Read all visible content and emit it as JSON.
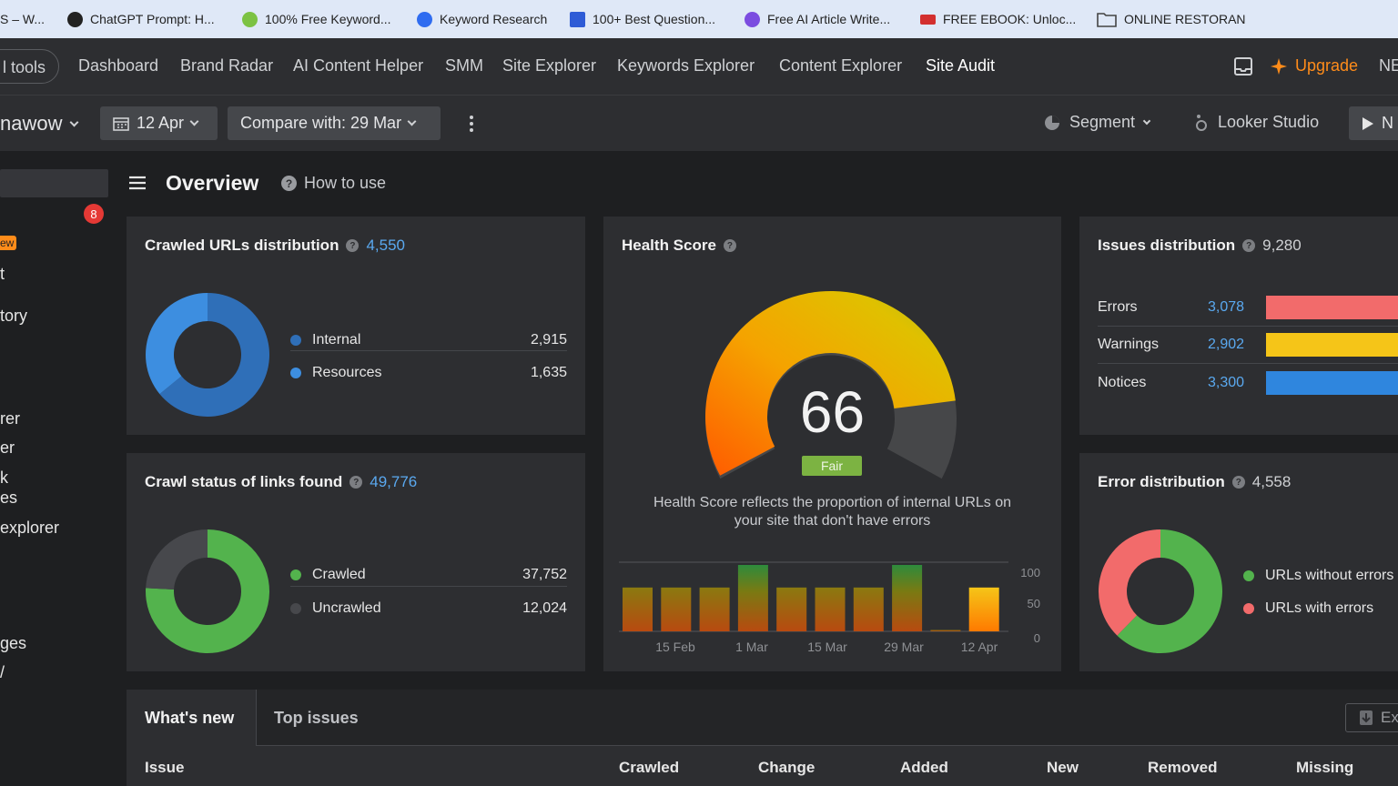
{
  "bookmarks": [
    {
      "label": "S – W...",
      "color": "#3b3b3b"
    },
    {
      "label": "ChatGPT Prompt: H...",
      "color": "#222222"
    },
    {
      "label": "100% Free Keyword...",
      "color": "#7cc243"
    },
    {
      "label": "Keyword Research",
      "color": "#2f6cf0"
    },
    {
      "label": "100+ Best Question...",
      "color": "#2e5bd6"
    },
    {
      "label": "Free AI Article Write...",
      "color": "#7b4ce0"
    },
    {
      "label": "FREE EBOOK: Unloc...",
      "color": "#d32f2f"
    },
    {
      "label": "ONLINE RESTORAN",
      "color": "folder"
    }
  ],
  "topnav": {
    "all_tools": "l tools",
    "items": [
      "Dashboard",
      "Brand Radar",
      "AI Content Helper",
      "SMM",
      "Site Explorer",
      "Keywords Explorer",
      "Content Explorer",
      "Site Audit"
    ],
    "upgrade": "Upgrade",
    "right_cut": "NE"
  },
  "projbar": {
    "project": "nawow",
    "date": "12 Apr",
    "compare": "Compare with: 29 Mar",
    "segment": "Segment",
    "looker": "Looker Studio",
    "run_cut": "N"
  },
  "sidebar": {
    "badge": "8",
    "new_tag": "ew",
    "items": [
      "t",
      "tory",
      "rer",
      "er",
      "k",
      "es",
      "explorer",
      "ges",
      "/"
    ]
  },
  "overview": {
    "title": "Overview",
    "how_to_use": "How to use"
  },
  "crawled_urls": {
    "title": "Crawled URLs distribution",
    "count": "4,550",
    "rows": [
      {
        "label": "Internal",
        "value": "2,915",
        "color": "#2f6fb8"
      },
      {
        "label": "Resources",
        "value": "1,635",
        "color": "#3d8ee0"
      }
    ]
  },
  "crawl_status": {
    "title": "Crawl status of links found",
    "count": "49,776",
    "rows": [
      {
        "label": "Crawled",
        "value": "37,752",
        "color": "#53b34d"
      },
      {
        "label": "Uncrawled",
        "value": "12,024",
        "color": "#47484c"
      }
    ]
  },
  "health": {
    "title": "Health Score",
    "score": "66",
    "rating": "Fair",
    "description_line1": "Health Score reflects the proportion of internal URLs on",
    "description_line2": "your site that don't have errors"
  },
  "chart_data": {
    "type": "bar",
    "ylim": [
      0,
      100
    ],
    "yticks": [
      "100",
      "50",
      "0"
    ],
    "xticks": [
      "15 Feb",
      "1 Mar",
      "15 Mar",
      "29 Mar",
      "12 Apr"
    ],
    "values": [
      66,
      66,
      66,
      100,
      66,
      66,
      66,
      100,
      2,
      66
    ]
  },
  "issues": {
    "title": "Issues distribution",
    "count": "9,280",
    "rows": [
      {
        "label": "Errors",
        "value": "3,078",
        "color": "#f26b6b"
      },
      {
        "label": "Warnings",
        "value": "2,902",
        "color": "#f5c518"
      },
      {
        "label": "Notices",
        "value": "3,300",
        "color": "#2f86de"
      }
    ]
  },
  "error_dist": {
    "title": "Error distribution",
    "count": "4,558",
    "rows": [
      {
        "label": "URLs without errors",
        "color": "#53b34d"
      },
      {
        "label": "URLs with errors",
        "color": "#f26b6b"
      }
    ]
  },
  "bottom": {
    "tabs": [
      "What's new",
      "Top issues"
    ],
    "columns": [
      "Issue",
      "Crawled",
      "Change",
      "Added",
      "New",
      "Removed",
      "Missing"
    ],
    "export_cut": "Ex"
  }
}
